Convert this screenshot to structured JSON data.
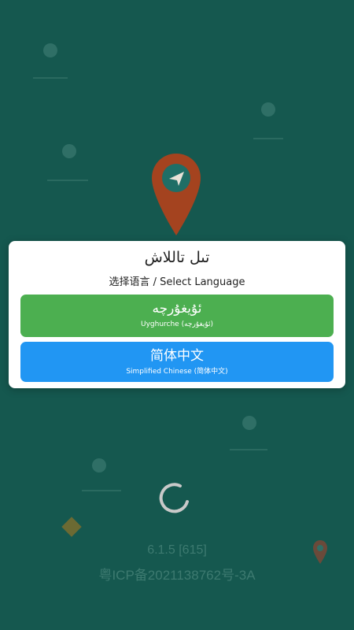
{
  "dialog": {
    "title": "تىل تاللاش",
    "subtitle": "选择语言 / Select Language",
    "options": [
      {
        "label": "ئۇيغۇرچە",
        "sublabel": "Uyghurche (ئۇيغۇرچە)",
        "color": "#4caf50"
      },
      {
        "label": "简体中文",
        "sublabel": "Simplified Chinese (简体中文)",
        "color": "#2196f3"
      }
    ]
  },
  "background": {
    "color": "#15584f",
    "logo_color": "#a4431f",
    "icons": [
      "map-pin-icon",
      "navigation-arrow-icon",
      "warning-sign-icon",
      "loading-spinner-icon"
    ]
  },
  "footer": {
    "version": "6.1.5 [615]",
    "icp": "粤ICP备2021138762号-3A"
  }
}
